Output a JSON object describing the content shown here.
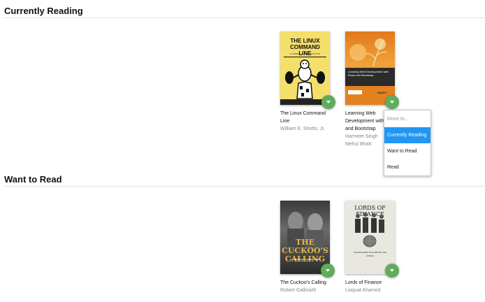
{
  "shelves": {
    "currently_reading": {
      "title": "Currently Reading",
      "books": [
        {
          "title": "The Linux Command Line",
          "authors": [
            "William E. Shotts, Jr."
          ],
          "cover_title": "THE LINUX COMMAND LINE",
          "cover_subtitle": "A COMPLETE INTRODUCTION"
        },
        {
          "title": "Learning Web Development with React and Bootstrap",
          "authors": [
            "Harmeet Singh",
            "Mehul Bhatt"
          ],
          "cover_title": "Learning Web Development with React and Bootstrap",
          "cover_publisher": "PACKT"
        }
      ]
    },
    "want_to_read": {
      "title": "Want to Read",
      "books": [
        {
          "title": "The Cuckoo's Calling",
          "authors": [
            "Robert Galbraith"
          ],
          "cover_title": "THE CUCKOO'S CALLING",
          "cover_subtitle": "A CORMORAN STRIKE NOVEL"
        },
        {
          "title": "Lords of Finance",
          "authors": [
            "Liaquat Ahamed"
          ],
          "cover_title": "LORDS OF FINANCE",
          "cover_subtitle": "THE BANKERS WHO BROKE THE WORLD"
        }
      ]
    }
  },
  "shelf_menu": {
    "header": "Move to...",
    "options": [
      "Currently Reading",
      "Want to Read",
      "Read"
    ],
    "selected": "Currently Reading"
  },
  "colors": {
    "changer_green": "#60ac5d",
    "menu_highlight": "#2196f3"
  }
}
